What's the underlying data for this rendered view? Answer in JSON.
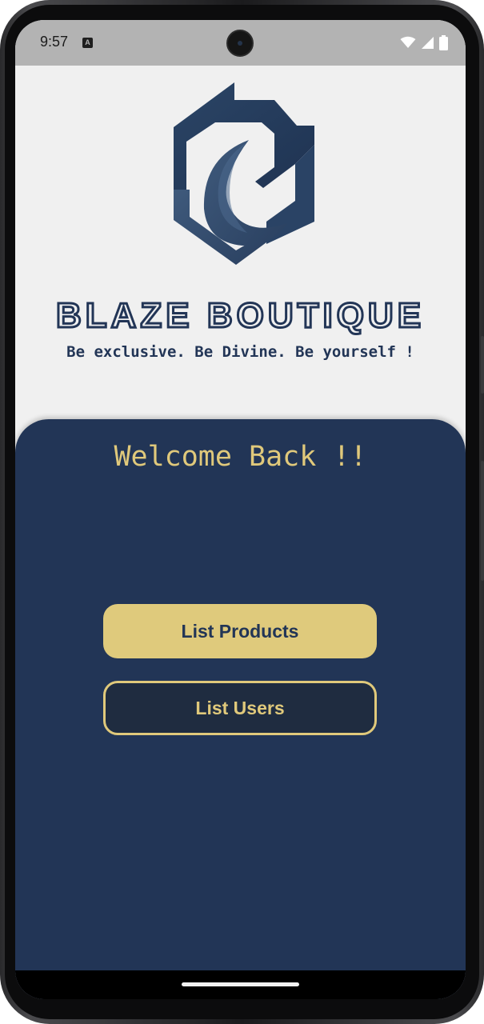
{
  "status_bar": {
    "time": "9:57",
    "notification_icon": "text-a-icon",
    "notification_glyph": "A",
    "icons": [
      "wifi-icon",
      "cell-signal-icon",
      "battery-icon"
    ]
  },
  "brand": {
    "logo_icon": "blaze-b-logo-icon",
    "name": "BLAZE BOUTIQUE",
    "tagline": "Be exclusive. Be Divine. Be yourself !"
  },
  "panel": {
    "welcome": "Welcome Back !!",
    "buttons": {
      "list_products": "List Products",
      "list_users": "List Users"
    }
  },
  "colors": {
    "navy": "#223556",
    "gold": "#dfca7c",
    "screen_bg": "#f0f0f0",
    "status_bar_bg": "#b3b3b3"
  }
}
